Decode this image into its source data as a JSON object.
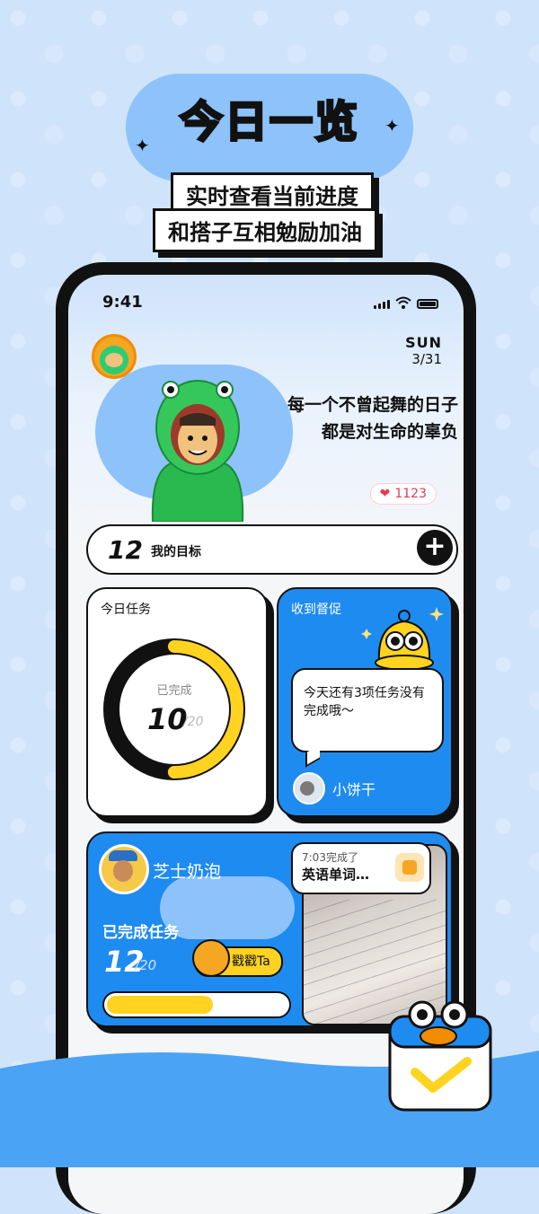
{
  "hero": {
    "title": "今日一览",
    "tagline1": "实时查看当前进度",
    "tagline2": "和搭子互相勉励加油"
  },
  "status_bar": {
    "time": "9:41"
  },
  "header": {
    "day": "SUN",
    "date": "3/31"
  },
  "banner": {
    "quote_line1": "每一个不曾起舞的日子",
    "quote_line2": "都是对生命的辜负",
    "likes": "1123"
  },
  "goal": {
    "count": "12",
    "label": "我的目标",
    "add_icon": "plus-icon"
  },
  "today_tasks": {
    "title": "今日任务",
    "done_label": "已完成",
    "done": 10,
    "done_text": "10",
    "total_text": "/20",
    "total": 20
  },
  "reminder": {
    "title": "收到督促",
    "message": "今天还有3项任务没有完成哦～",
    "sender": "小饼干"
  },
  "friend": {
    "name": "芝士奶泡",
    "done_label": "已完成任务",
    "done_text": "12",
    "total_text": "/20",
    "progress": 0.6,
    "poke_label": "戳戳Ta",
    "post_time": "7:03完成了",
    "post_text": "英语单词…"
  },
  "colors": {
    "accent_blue": "#1e8bf1",
    "accent_yellow": "#ffd320",
    "ink": "#111111"
  }
}
